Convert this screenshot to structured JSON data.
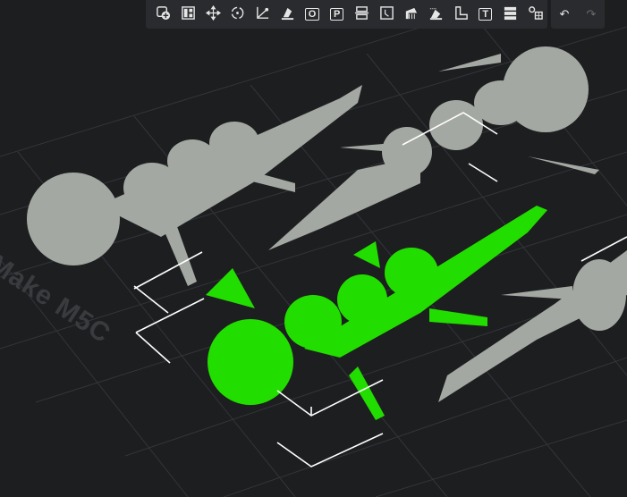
{
  "plate": {
    "label": "Make M5C"
  },
  "colors": {
    "background": "#1d1e20",
    "model": "#a4a8a3",
    "selected_model": "#22dd00",
    "toolbar": "#2a2b2e"
  },
  "toolbar": {
    "tools": [
      {
        "name": "add-object-icon"
      },
      {
        "name": "arrange-icon"
      },
      {
        "name": "move-icon"
      },
      {
        "name": "rotate-icon"
      },
      {
        "name": "scale-icon"
      },
      {
        "name": "place-on-face-icon"
      },
      {
        "name": "orient-icon",
        "glyph": "O"
      },
      {
        "name": "paint-icon",
        "glyph": "P"
      },
      {
        "name": "cut-icon"
      },
      {
        "name": "seam-icon"
      },
      {
        "name": "support-paint-icon"
      },
      {
        "name": "fuzzy-skin-icon"
      },
      {
        "name": "measure-icon"
      },
      {
        "name": "text-icon",
        "glyph": "T"
      },
      {
        "name": "layers-icon"
      },
      {
        "name": "assembly-icon"
      }
    ],
    "undo": {
      "name": "undo-icon",
      "glyph": "↶"
    },
    "redo": {
      "name": "redo-icon",
      "glyph": "↷"
    }
  }
}
